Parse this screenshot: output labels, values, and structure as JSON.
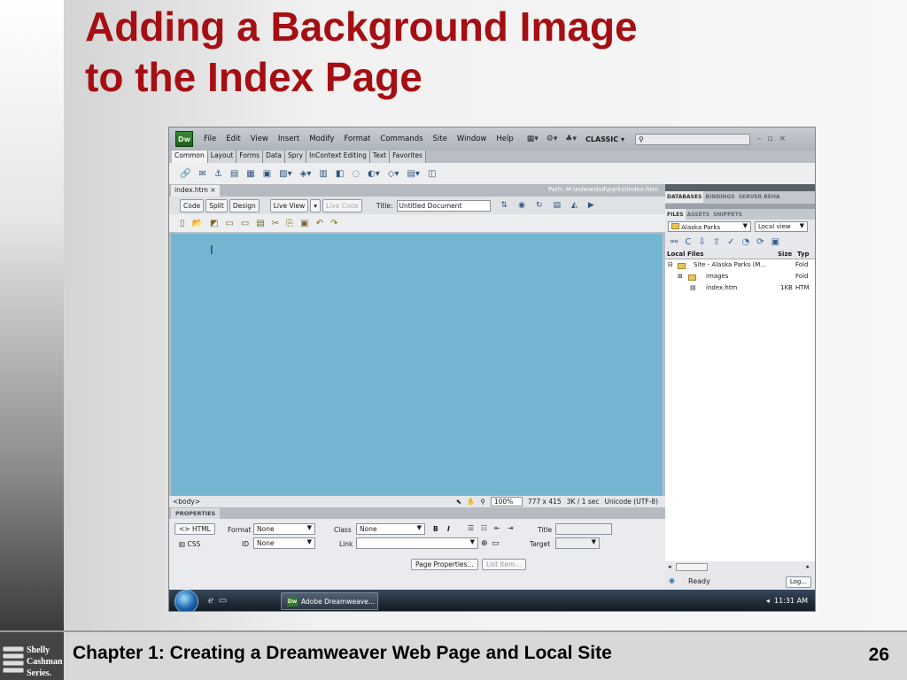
{
  "slide": {
    "title_line1": "Adding a Background Image",
    "title_line2": "to the Index Page",
    "footer_chapter": "Chapter 1: Creating a Dreamweaver Web Page and Local Site",
    "page_number": "26",
    "logo_lines": [
      "Shelly",
      "Cashman",
      "Series."
    ]
  },
  "app": {
    "logo": "Dw",
    "menu": [
      "File",
      "Edit",
      "View",
      "Insert",
      "Modify",
      "Format",
      "Commands",
      "Site",
      "Window",
      "Help"
    ],
    "workspace": "CLASSIC",
    "search_placeholder": "",
    "insert_tabs": [
      "Common",
      "Layout",
      "Forms",
      "Data",
      "Spry",
      "InContext Editing",
      "Text",
      "Favorites"
    ],
    "doc_tab": "index.htm",
    "path_label": "Path: M:\\edwardsd\\parks\\index.htm",
    "view_buttons": {
      "code": "Code",
      "split": "Split",
      "design": "Design",
      "live_view": "Live View",
      "live_code": "Live Code"
    },
    "title_label": "Title:",
    "title_value": "Untitled Document",
    "status": {
      "tag": "<body>",
      "zoom": "100%",
      "size": "777 x 415",
      "download": "3K / 1 sec",
      "encoding": "Unicode (UTF-8)"
    },
    "properties": {
      "header": "PROPERTIES",
      "html_btn": "HTML",
      "css_btn": "CSS",
      "format_label": "Format",
      "format_value": "None",
      "class_label": "Class",
      "class_value": "None",
      "id_label": "ID",
      "id_value": "None",
      "link_label": "Link",
      "title_label": "Title",
      "target_label": "Target",
      "bold": "B",
      "italic": "I",
      "page_properties": "Page Properties...",
      "list_item": "List Item..."
    },
    "panels": {
      "tabs1": [
        "DATABASES",
        "BINDINGS",
        "SERVER BEHA"
      ],
      "tabs2": [
        "FILES",
        "ASSETS",
        "SNIPPETS"
      ],
      "site_select": "Alaska Parks",
      "view_select": "Local view",
      "files_header": {
        "name": "Local Files",
        "size": "Size",
        "type": "Typ"
      },
      "files": [
        {
          "name": "Site - Alaska Parks (M...",
          "size": "",
          "type": "Fold"
        },
        {
          "name": "images",
          "size": "",
          "type": "Fold"
        },
        {
          "name": "index.htm",
          "size": "1KB",
          "type": "HTM"
        }
      ],
      "status": "Ready",
      "log_btn": "Log..."
    },
    "taskbar": {
      "app_item": "Adobe Dreamweave...",
      "clock": "11:31 AM"
    }
  },
  "colors": {
    "title_red": "#a50f13",
    "design_view_blue": "#74b6d2"
  }
}
